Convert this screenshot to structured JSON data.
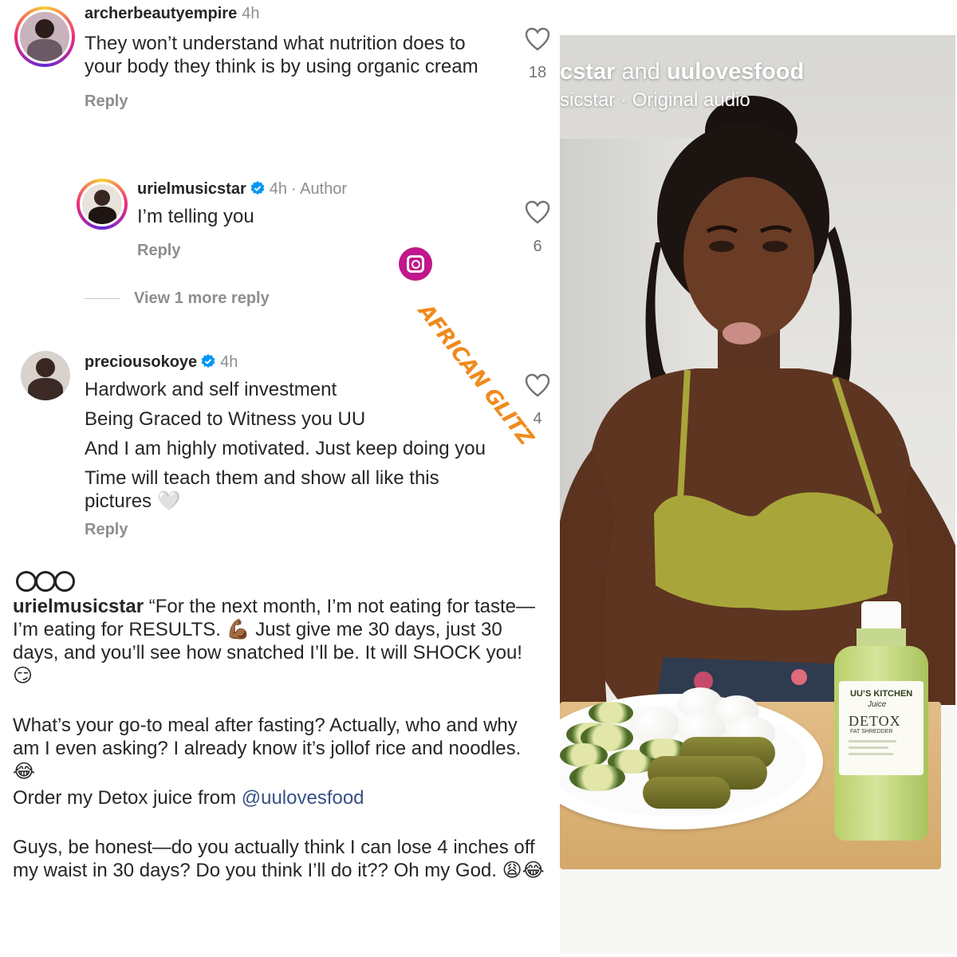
{
  "comments": [
    {
      "username": "archerbeautyempire",
      "time": "4h",
      "text": "They won’t understand what nutrition does to your body they think is by using organic cream",
      "reply_label": "Reply",
      "likes": "18"
    },
    {
      "username": "urielmusicstar",
      "time": "4h",
      "author_label": "· Author",
      "text": "I’m telling you",
      "reply_label": "Reply",
      "likes": "6"
    },
    {
      "username": "preciousokoye",
      "time": "4h",
      "lines": [
        "Hardwork and self investment",
        "Being Graced to  Witness you UU",
        "And I am highly motivated. Just keep doing you",
        "Time will teach them and show all like this pictures 🤍"
      ],
      "reply_label": "Reply",
      "likes": "4"
    }
  ],
  "view_more_replies": "View 1 more reply",
  "watermark": "AFRICAN GLITZ",
  "caption": {
    "username": "urielmusicstar",
    "p1": "“For the next month, I’m not eating for taste—I’m eating for RESULTS. 💪🏾 Just give me 30 days, just 30 days, and you’ll see how snatched I’ll be. It will SHOCK you! 😏",
    "p2": "What’s your go-to meal after fasting? Actually, who and why am I even asking? I already know it’s jollof rice and noodles. 😂",
    "p3_prefix": "Order my Detox juice from ",
    "p3_mention": "@uulovesfood",
    "p4": "Guys, be honest—do you actually think I can lose 4 inches off my waist in 30 days? Do you think I’ll do it?? Oh my God. 😩😂"
  },
  "video": {
    "title_part1": "cstar",
    "title_and": " and ",
    "title_part2": "uulovesfood",
    "subtitle": "sicstar · Original audio",
    "bottle_brand": "UU’S KITCHEN",
    "bottle_juice": "Juice",
    "bottle_detox": "DETOX",
    "bottle_fat": "FAT SHREDDER"
  },
  "colors": {
    "verified": "#0095f6",
    "mention": "#385185",
    "watermark": "#f08a1c",
    "watermark_icon": "#c0178c"
  }
}
